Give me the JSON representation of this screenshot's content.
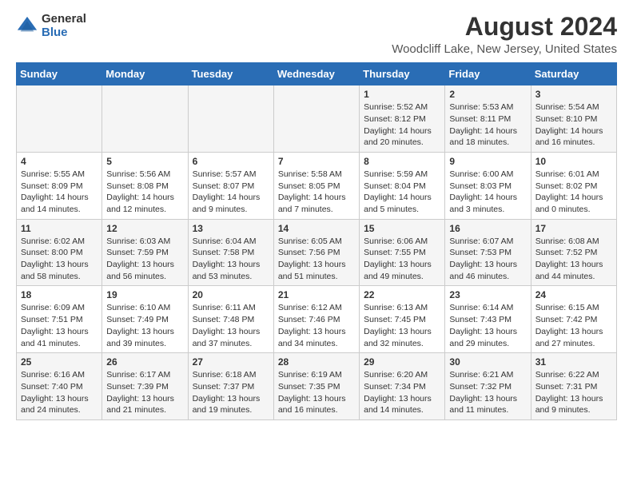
{
  "logo": {
    "general": "General",
    "blue": "Blue"
  },
  "title": "August 2024",
  "subtitle": "Woodcliff Lake, New Jersey, United States",
  "weekdays": [
    "Sunday",
    "Monday",
    "Tuesday",
    "Wednesday",
    "Thursday",
    "Friday",
    "Saturday"
  ],
  "weeks": [
    [
      {
        "day": "",
        "content": ""
      },
      {
        "day": "",
        "content": ""
      },
      {
        "day": "",
        "content": ""
      },
      {
        "day": "",
        "content": ""
      },
      {
        "day": "1",
        "content": "Sunrise: 5:52 AM\nSunset: 8:12 PM\nDaylight: 14 hours\nand 20 minutes."
      },
      {
        "day": "2",
        "content": "Sunrise: 5:53 AM\nSunset: 8:11 PM\nDaylight: 14 hours\nand 18 minutes."
      },
      {
        "day": "3",
        "content": "Sunrise: 5:54 AM\nSunset: 8:10 PM\nDaylight: 14 hours\nand 16 minutes."
      }
    ],
    [
      {
        "day": "4",
        "content": "Sunrise: 5:55 AM\nSunset: 8:09 PM\nDaylight: 14 hours\nand 14 minutes."
      },
      {
        "day": "5",
        "content": "Sunrise: 5:56 AM\nSunset: 8:08 PM\nDaylight: 14 hours\nand 12 minutes."
      },
      {
        "day": "6",
        "content": "Sunrise: 5:57 AM\nSunset: 8:07 PM\nDaylight: 14 hours\nand 9 minutes."
      },
      {
        "day": "7",
        "content": "Sunrise: 5:58 AM\nSunset: 8:05 PM\nDaylight: 14 hours\nand 7 minutes."
      },
      {
        "day": "8",
        "content": "Sunrise: 5:59 AM\nSunset: 8:04 PM\nDaylight: 14 hours\nand 5 minutes."
      },
      {
        "day": "9",
        "content": "Sunrise: 6:00 AM\nSunset: 8:03 PM\nDaylight: 14 hours\nand 3 minutes."
      },
      {
        "day": "10",
        "content": "Sunrise: 6:01 AM\nSunset: 8:02 PM\nDaylight: 14 hours\nand 0 minutes."
      }
    ],
    [
      {
        "day": "11",
        "content": "Sunrise: 6:02 AM\nSunset: 8:00 PM\nDaylight: 13 hours\nand 58 minutes."
      },
      {
        "day": "12",
        "content": "Sunrise: 6:03 AM\nSunset: 7:59 PM\nDaylight: 13 hours\nand 56 minutes."
      },
      {
        "day": "13",
        "content": "Sunrise: 6:04 AM\nSunset: 7:58 PM\nDaylight: 13 hours\nand 53 minutes."
      },
      {
        "day": "14",
        "content": "Sunrise: 6:05 AM\nSunset: 7:56 PM\nDaylight: 13 hours\nand 51 minutes."
      },
      {
        "day": "15",
        "content": "Sunrise: 6:06 AM\nSunset: 7:55 PM\nDaylight: 13 hours\nand 49 minutes."
      },
      {
        "day": "16",
        "content": "Sunrise: 6:07 AM\nSunset: 7:53 PM\nDaylight: 13 hours\nand 46 minutes."
      },
      {
        "day": "17",
        "content": "Sunrise: 6:08 AM\nSunset: 7:52 PM\nDaylight: 13 hours\nand 44 minutes."
      }
    ],
    [
      {
        "day": "18",
        "content": "Sunrise: 6:09 AM\nSunset: 7:51 PM\nDaylight: 13 hours\nand 41 minutes."
      },
      {
        "day": "19",
        "content": "Sunrise: 6:10 AM\nSunset: 7:49 PM\nDaylight: 13 hours\nand 39 minutes."
      },
      {
        "day": "20",
        "content": "Sunrise: 6:11 AM\nSunset: 7:48 PM\nDaylight: 13 hours\nand 37 minutes."
      },
      {
        "day": "21",
        "content": "Sunrise: 6:12 AM\nSunset: 7:46 PM\nDaylight: 13 hours\nand 34 minutes."
      },
      {
        "day": "22",
        "content": "Sunrise: 6:13 AM\nSunset: 7:45 PM\nDaylight: 13 hours\nand 32 minutes."
      },
      {
        "day": "23",
        "content": "Sunrise: 6:14 AM\nSunset: 7:43 PM\nDaylight: 13 hours\nand 29 minutes."
      },
      {
        "day": "24",
        "content": "Sunrise: 6:15 AM\nSunset: 7:42 PM\nDaylight: 13 hours\nand 27 minutes."
      }
    ],
    [
      {
        "day": "25",
        "content": "Sunrise: 6:16 AM\nSunset: 7:40 PM\nDaylight: 13 hours\nand 24 minutes."
      },
      {
        "day": "26",
        "content": "Sunrise: 6:17 AM\nSunset: 7:39 PM\nDaylight: 13 hours\nand 21 minutes."
      },
      {
        "day": "27",
        "content": "Sunrise: 6:18 AM\nSunset: 7:37 PM\nDaylight: 13 hours\nand 19 minutes."
      },
      {
        "day": "28",
        "content": "Sunrise: 6:19 AM\nSunset: 7:35 PM\nDaylight: 13 hours\nand 16 minutes."
      },
      {
        "day": "29",
        "content": "Sunrise: 6:20 AM\nSunset: 7:34 PM\nDaylight: 13 hours\nand 14 minutes."
      },
      {
        "day": "30",
        "content": "Sunrise: 6:21 AM\nSunset: 7:32 PM\nDaylight: 13 hours\nand 11 minutes."
      },
      {
        "day": "31",
        "content": "Sunrise: 6:22 AM\nSunset: 7:31 PM\nDaylight: 13 hours\nand 9 minutes."
      }
    ]
  ]
}
